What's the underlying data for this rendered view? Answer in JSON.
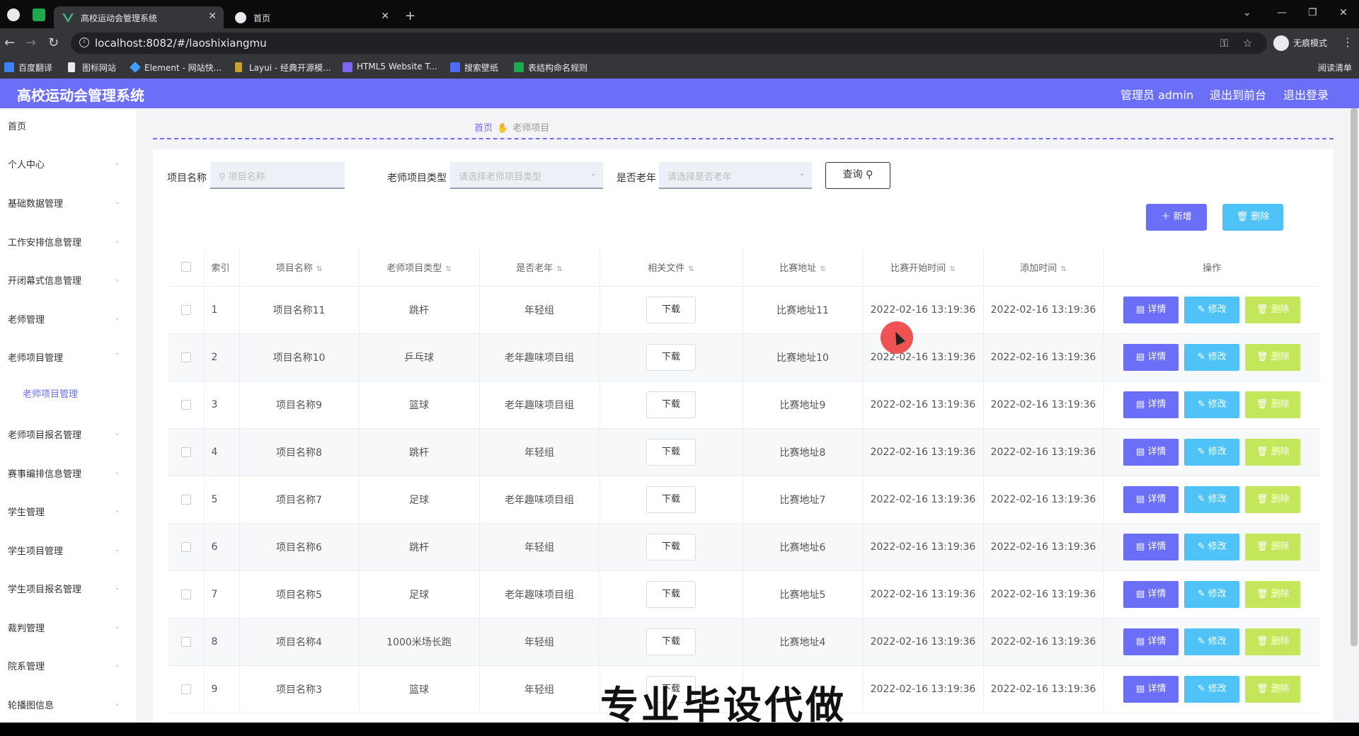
{
  "browser": {
    "tabs": [
      {
        "title": "高校运动会管理系统",
        "active": true
      },
      {
        "title": "首页",
        "active": false
      }
    ],
    "url": "localhost:8082/#/laoshixiangmu",
    "profile_label": "无痕模式",
    "reading_list": "阅读清单",
    "bookmarks": [
      "百度翻译",
      "图标网站",
      "Element - 网站快...",
      "Layui - 经典开源模...",
      "HTML5 Website T...",
      "搜索壁纸",
      "表结构命名规则"
    ]
  },
  "header": {
    "title": "高校运动会管理系统",
    "admin": "管理员 admin",
    "to_front": "退出到前台",
    "logout": "退出登录"
  },
  "sidebar": {
    "items": [
      {
        "label": "首页",
        "chevron": false
      },
      {
        "label": "个人中心",
        "chevron": true
      },
      {
        "label": "基础数据管理",
        "chevron": true
      },
      {
        "label": "工作安排信息管理",
        "chevron": true
      },
      {
        "label": "开闭幕式信息管理",
        "chevron": true
      },
      {
        "label": "老师管理",
        "chevron": true
      },
      {
        "label": "老师项目管理",
        "chevron": true
      },
      {
        "label": "老师项目管理",
        "chevron": false,
        "sub": true
      },
      {
        "label": "老师项目报名管理",
        "chevron": true
      },
      {
        "label": "赛事编排信息管理",
        "chevron": true
      },
      {
        "label": "学生管理",
        "chevron": true
      },
      {
        "label": "学生项目管理",
        "chevron": true
      },
      {
        "label": "学生项目报名管理",
        "chevron": true
      },
      {
        "label": "裁判管理",
        "chevron": true
      },
      {
        "label": "院系管理",
        "chevron": true
      },
      {
        "label": "轮播图信息",
        "chevron": true
      }
    ]
  },
  "breadcrumb": {
    "home": "首页",
    "current": "老师项目"
  },
  "filters": {
    "name_label": "项目名称",
    "name_placeholder": "项目名称",
    "type_label": "老师项目类型",
    "type_placeholder": "请选择老师项目类型",
    "elder_label": "是否老年",
    "elder_placeholder": "请选择是否老年",
    "search_button": "查询"
  },
  "actions": {
    "add": "新增",
    "batch_delete": "删除"
  },
  "table": {
    "headers": [
      "索引",
      "项目名称",
      "老师项目类型",
      "是否老年",
      "相关文件",
      "比赛地址",
      "比赛开始时间",
      "添加时间",
      "操作"
    ],
    "download_label": "下载",
    "detail_label": "详情",
    "edit_label": "修改",
    "delete_label": "删除",
    "rows": [
      {
        "index": "1",
        "name": "项目名称11",
        "type": "跳杆",
        "elder": "年轻组",
        "address": "比赛地址11",
        "start": "2022-02-16 13:19:36",
        "added": "2022-02-16 13:19:36"
      },
      {
        "index": "2",
        "name": "项目名称10",
        "type": "乒乓球",
        "elder": "老年趣味项目组",
        "address": "比赛地址10",
        "start": "2022-02-16 13:19:36",
        "added": "2022-02-16 13:19:36"
      },
      {
        "index": "3",
        "name": "项目名称9",
        "type": "篮球",
        "elder": "老年趣味项目组",
        "address": "比赛地址9",
        "start": "2022-02-16 13:19:36",
        "added": "2022-02-16 13:19:36"
      },
      {
        "index": "4",
        "name": "项目名称8",
        "type": "跳杆",
        "elder": "年轻组",
        "address": "比赛地址8",
        "start": "2022-02-16 13:19:36",
        "added": "2022-02-16 13:19:36"
      },
      {
        "index": "5",
        "name": "项目名称7",
        "type": "足球",
        "elder": "老年趣味项目组",
        "address": "比赛地址7",
        "start": "2022-02-16 13:19:36",
        "added": "2022-02-16 13:19:36"
      },
      {
        "index": "6",
        "name": "项目名称6",
        "type": "跳杆",
        "elder": "年轻组",
        "address": "比赛地址6",
        "start": "2022-02-16 13:19:36",
        "added": "2022-02-16 13:19:36"
      },
      {
        "index": "7",
        "name": "项目名称5",
        "type": "足球",
        "elder": "老年趣味项目组",
        "address": "比赛地址5",
        "start": "2022-02-16 13:19:36",
        "added": "2022-02-16 13:19:36"
      },
      {
        "index": "8",
        "name": "项目名称4",
        "type": "1000米场长跑",
        "elder": "年轻组",
        "address": "比赛地址4",
        "start": "2022-02-16 13:19:36",
        "added": "2022-02-16 13:19:36"
      },
      {
        "index": "9",
        "name": "项目名称3",
        "type": "篮球",
        "elder": "年轻组",
        "address": "",
        "start": "2022-02-16 13:19:36",
        "added": "2022-02-16 13:19:36"
      }
    ]
  },
  "watermark": "专业毕设代做",
  "colors": {
    "primary": "#6b6ef7",
    "edit": "#4fc3f7",
    "delete": "#c4e65a"
  }
}
